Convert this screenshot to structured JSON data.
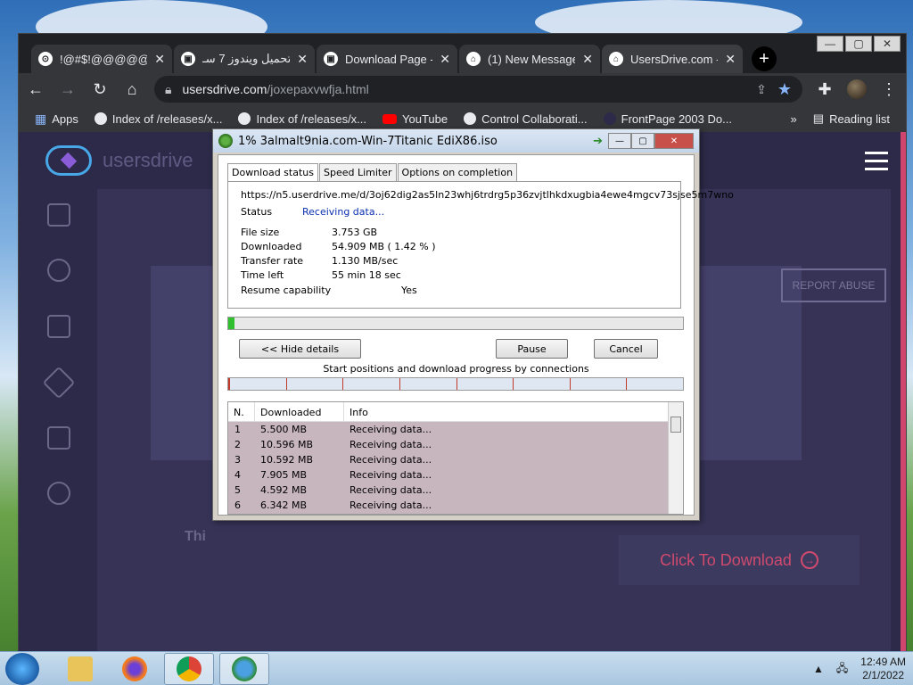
{
  "browser": {
    "tabs": [
      {
        "title": "!@#$!@@@@@",
        "active": false
      },
      {
        "title": "تحميل ويندوز 7 سـ",
        "active": false
      },
      {
        "title": "Download Page -",
        "active": false
      },
      {
        "title": "(1) New Message!",
        "active": false
      },
      {
        "title": "UsersDrive.com -",
        "active": true
      }
    ],
    "new_tab": "+",
    "url_host": "usersdrive.com",
    "url_path": "/joxepaxvwfja.html",
    "bookmarks": [
      {
        "label": "Apps",
        "icon": "apps-grid-icon"
      },
      {
        "label": "Index of /releases/x...",
        "icon": "globe-icon"
      },
      {
        "label": "Index of /releases/x...",
        "icon": "globe-icon"
      },
      {
        "label": "YouTube",
        "icon": "youtube-icon"
      },
      {
        "label": "Control Collaborati...",
        "icon": "globe-icon"
      },
      {
        "label": "FrontPage 2003 Do...",
        "icon": "globe-icon"
      }
    ],
    "more_bookmarks": "»",
    "reading_list": "Reading list",
    "window_controls": {
      "minimize": "—",
      "maximize": "▢",
      "close": "✕"
    }
  },
  "page": {
    "brand": "usersdrive",
    "report_abuse": "REPORT ABUSE",
    "partial_text": "Thi",
    "download_button": "Click To Download"
  },
  "idm": {
    "title": "1% 3almalt9nia.com-Win-7Titanic EdiX86.iso",
    "tabs": [
      "Download status",
      "Speed Limiter",
      "Options on completion"
    ],
    "url": "https://n5.userdrive.me/d/3oj62dig2as5ln23whj6trdrg5p36zvjtlhkdxugbia4ewe4mgcv73sjse5m7wno",
    "status_label": "Status",
    "status_value": "Receiving data...",
    "file_size_label": "File size",
    "file_size_value": "3.753  GB",
    "downloaded_label": "Downloaded",
    "downloaded_value": "54.909  MB  ( 1.42 % )",
    "transfer_label": "Transfer rate",
    "transfer_value": "1.130  MB/sec",
    "time_left_label": "Time left",
    "time_left_value": "55 min 18 sec",
    "resume_label": "Resume capability",
    "resume_value": "Yes",
    "progress_fraction": 0.0142,
    "hide_details": "<< Hide details",
    "pause": "Pause",
    "cancel": "Cancel",
    "connections_caption": "Start positions and download progress by connections",
    "columns": [
      "N.",
      "Downloaded",
      "Info"
    ],
    "rows": [
      {
        "n": "1",
        "downloaded": "5.500  MB",
        "info": "Receiving data..."
      },
      {
        "n": "2",
        "downloaded": "10.596  MB",
        "info": "Receiving data..."
      },
      {
        "n": "3",
        "downloaded": "10.592  MB",
        "info": "Receiving data..."
      },
      {
        "n": "4",
        "downloaded": "7.905  MB",
        "info": "Receiving data..."
      },
      {
        "n": "5",
        "downloaded": "4.592  MB",
        "info": "Receiving data..."
      },
      {
        "n": "6",
        "downloaded": "6.342  MB",
        "info": "Receiving data..."
      }
    ]
  },
  "taskbar": {
    "time": "12:49 AM",
    "date": "2/1/2022",
    "apps": [
      "file-explorer-icon",
      "firefox-icon",
      "chrome-icon",
      "idm-icon"
    ]
  }
}
